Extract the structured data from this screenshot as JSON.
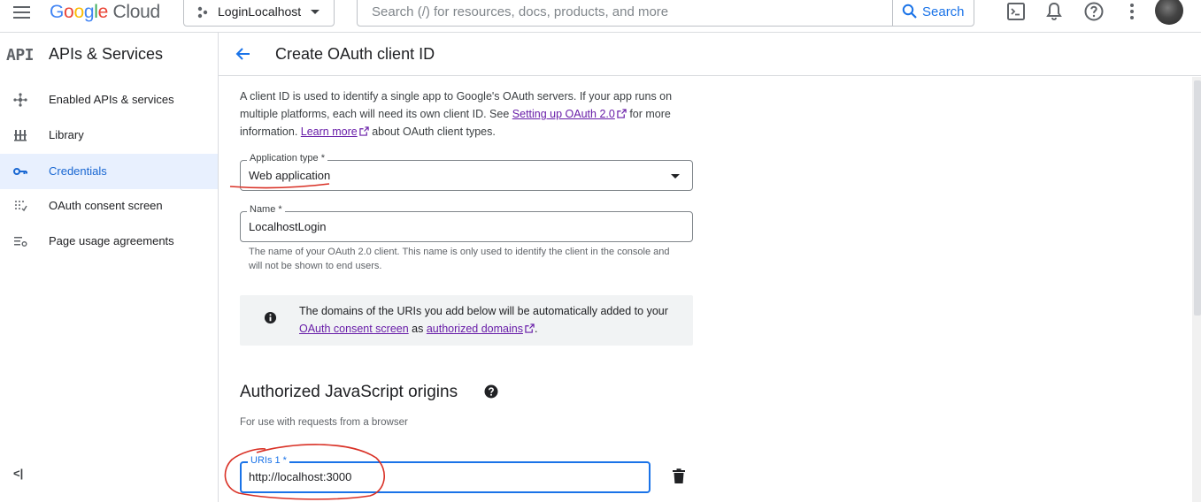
{
  "header": {
    "logo": {
      "g1": "G",
      "g2": "o",
      "g3": "o",
      "g4": "g",
      "g5": "l",
      "g6": "e",
      "cloud": " Cloud"
    },
    "project": "LoginLocalhost",
    "search_placeholder": "Search (/) for resources, docs, products, and more",
    "search_button": "Search"
  },
  "sidebar": {
    "badge": "API",
    "title": "APIs & Services",
    "items": [
      {
        "label": "Enabled APIs & services",
        "icon": "dashboard-icon",
        "active": false
      },
      {
        "label": "Library",
        "icon": "library-icon",
        "active": false
      },
      {
        "label": "Credentials",
        "icon": "key-icon",
        "active": true
      },
      {
        "label": "OAuth consent screen",
        "icon": "consent-icon",
        "active": false
      },
      {
        "label": "Page usage agreements",
        "icon": "settings-list-icon",
        "active": false
      }
    ],
    "collapse": "<|"
  },
  "page": {
    "title": "Create OAuth client ID",
    "intro": {
      "part1": "A client ID is used to identify a single app to Google's OAuth servers. If your app runs on multiple platforms, each will need its own client ID. See ",
      "link1": "Setting up OAuth 2.0",
      "part2": " for more information. ",
      "link2": "Learn more",
      "part3": " about OAuth client types."
    },
    "app_type": {
      "label": "Application type *",
      "value": "Web application"
    },
    "name": {
      "label": "Name *",
      "value": "LocalhostLogin",
      "helper": "The name of your OAuth 2.0 client. This name is only used to identify the client in the console and will not be shown to end users."
    },
    "info": {
      "part1": "The domains of the URIs you add below will be automatically added to your ",
      "link1": "OAuth consent screen",
      "part2": " as ",
      "link2": "authorized domains",
      "part3": "."
    },
    "js_origins": {
      "title": "Authorized JavaScript origins",
      "subtitle": "For use with requests from a browser",
      "uri_label": "URIs 1 *",
      "uri_value": "http://localhost:3000"
    }
  },
  "colors": {
    "accent": "#1a73e8",
    "active_bg": "#e8f0fe",
    "link": "#681da8",
    "annotation": "#d93025"
  }
}
